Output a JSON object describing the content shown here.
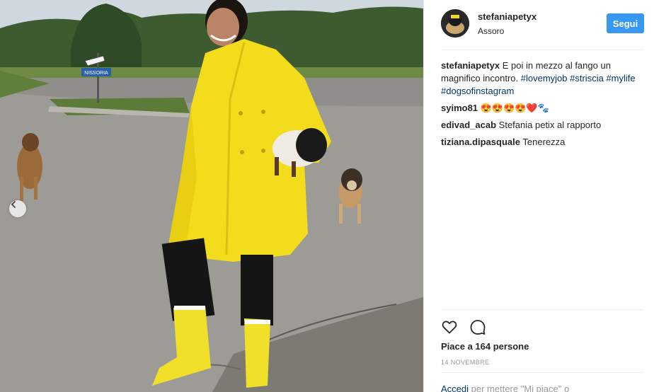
{
  "post": {
    "username": "stefaniapetyx",
    "location": "Assoro",
    "follow_label": "Segui"
  },
  "photo": {
    "sign_text": "NISSORIA"
  },
  "caption": {
    "username": "stefaniapetyx",
    "text": "E poi in mezzo al fango un magnifico incontro.",
    "hashtags": [
      "#lovemyjob",
      "#striscia",
      "#mylife",
      "#dogsofinstagram"
    ]
  },
  "comments": [
    {
      "username": "syimo81",
      "text": "😍😍😍😍❤️🐾"
    },
    {
      "username": "edivad_acab",
      "text": "Stefania petix al rapporto"
    },
    {
      "username": "tiziana.dipasquale",
      "text": "Tenerezza"
    }
  ],
  "likes": "Piace a 164 persone",
  "date": "14 NOVEMBRE",
  "login": {
    "link": "Accedi",
    "text": " per mettere \"Mi piace\" o"
  },
  "colors": {
    "follow_button": "#3897f0",
    "hashtag": "#003569",
    "coat": "#f2dc1c"
  },
  "icons": [
    "chevron-left-icon",
    "heart-icon",
    "comment-icon"
  ]
}
